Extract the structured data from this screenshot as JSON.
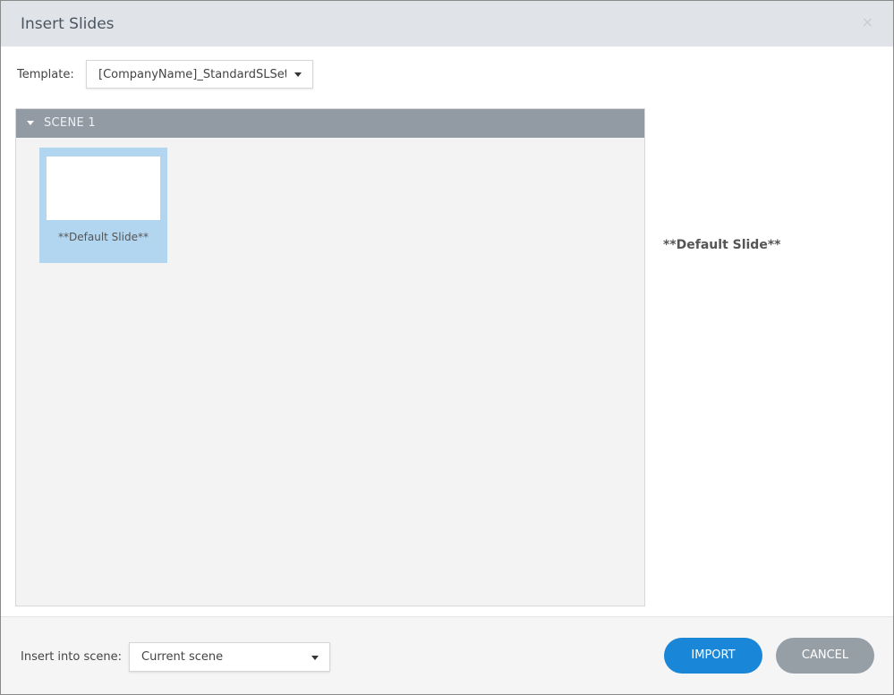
{
  "dialog": {
    "title": "Insert Slides",
    "close_icon": "×"
  },
  "template": {
    "label": "Template:",
    "value": "[CompanyName]_StandardSLSet"
  },
  "scene": {
    "name": "SCENE 1",
    "slides": [
      {
        "caption": "**Default Slide**"
      }
    ]
  },
  "preview": {
    "title": "**Default Slide**"
  },
  "footer": {
    "insert_label": "Insert into scene:",
    "insert_value": "Current scene",
    "import_label": "IMPORT",
    "cancel_label": "CANCEL"
  },
  "colors": {
    "import": "#1a86d8",
    "cancel": "#979fa6"
  }
}
